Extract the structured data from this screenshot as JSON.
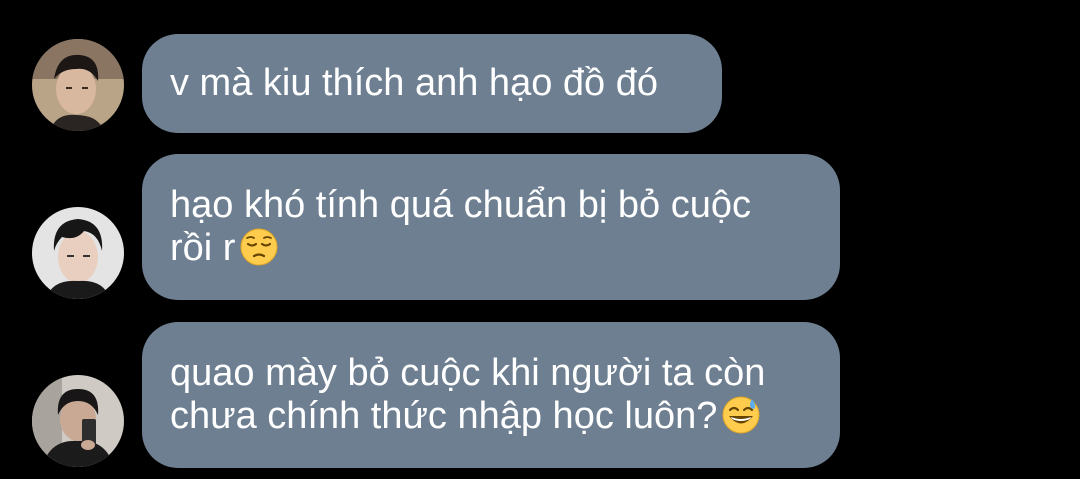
{
  "colors": {
    "background": "#000000",
    "bubble": "#6d7f91",
    "text": "#ffffff"
  },
  "messages": [
    {
      "avatar_icon": "user-avatar-1",
      "lines": [
        "v mà kiu thích anh hạo đồ đó"
      ],
      "emoji": null
    },
    {
      "avatar_icon": "user-avatar-2",
      "lines": [
        "hạo khó tính quá chuẩn bị bỏ cuộc",
        "rồi r"
      ],
      "emoji": "pensive-face-emoji"
    },
    {
      "avatar_icon": "user-avatar-3",
      "lines": [
        "quao mày bỏ cuộc khi người ta còn",
        "chưa chính thức nhập học luôn?"
      ],
      "emoji": "grinning-sweat-emoji"
    }
  ]
}
